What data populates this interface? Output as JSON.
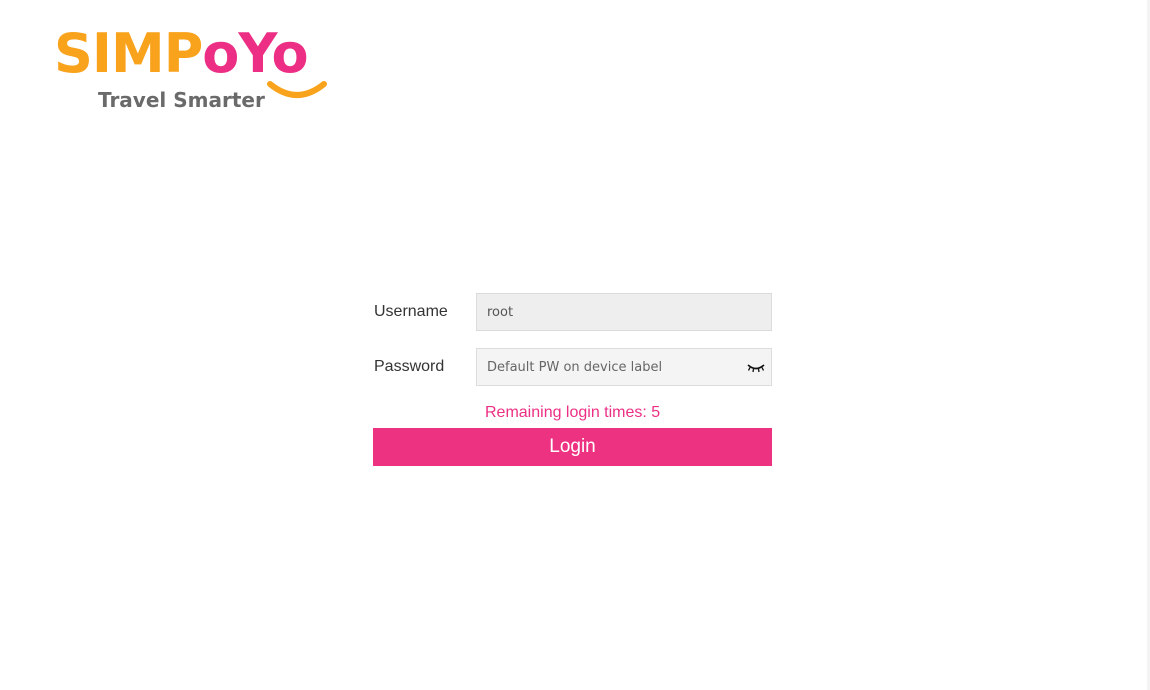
{
  "brand": {
    "name_part_a": "SIMP",
    "name_part_b": "oYo",
    "tagline": "Travel Smarter",
    "colors": {
      "orange": "#f9a21b",
      "pink": "#ec2f84"
    }
  },
  "form": {
    "username_label": "Username",
    "username_value": "root",
    "password_label": "Password",
    "password_placeholder": "Default PW on device label",
    "password_toggle_icon": "eye-closed-icon",
    "remaining_text": "Remaining login times: 5",
    "login_label": "Login"
  },
  "colors": {
    "accent": "#ee3282",
    "field_bg": "#eeeeee"
  }
}
